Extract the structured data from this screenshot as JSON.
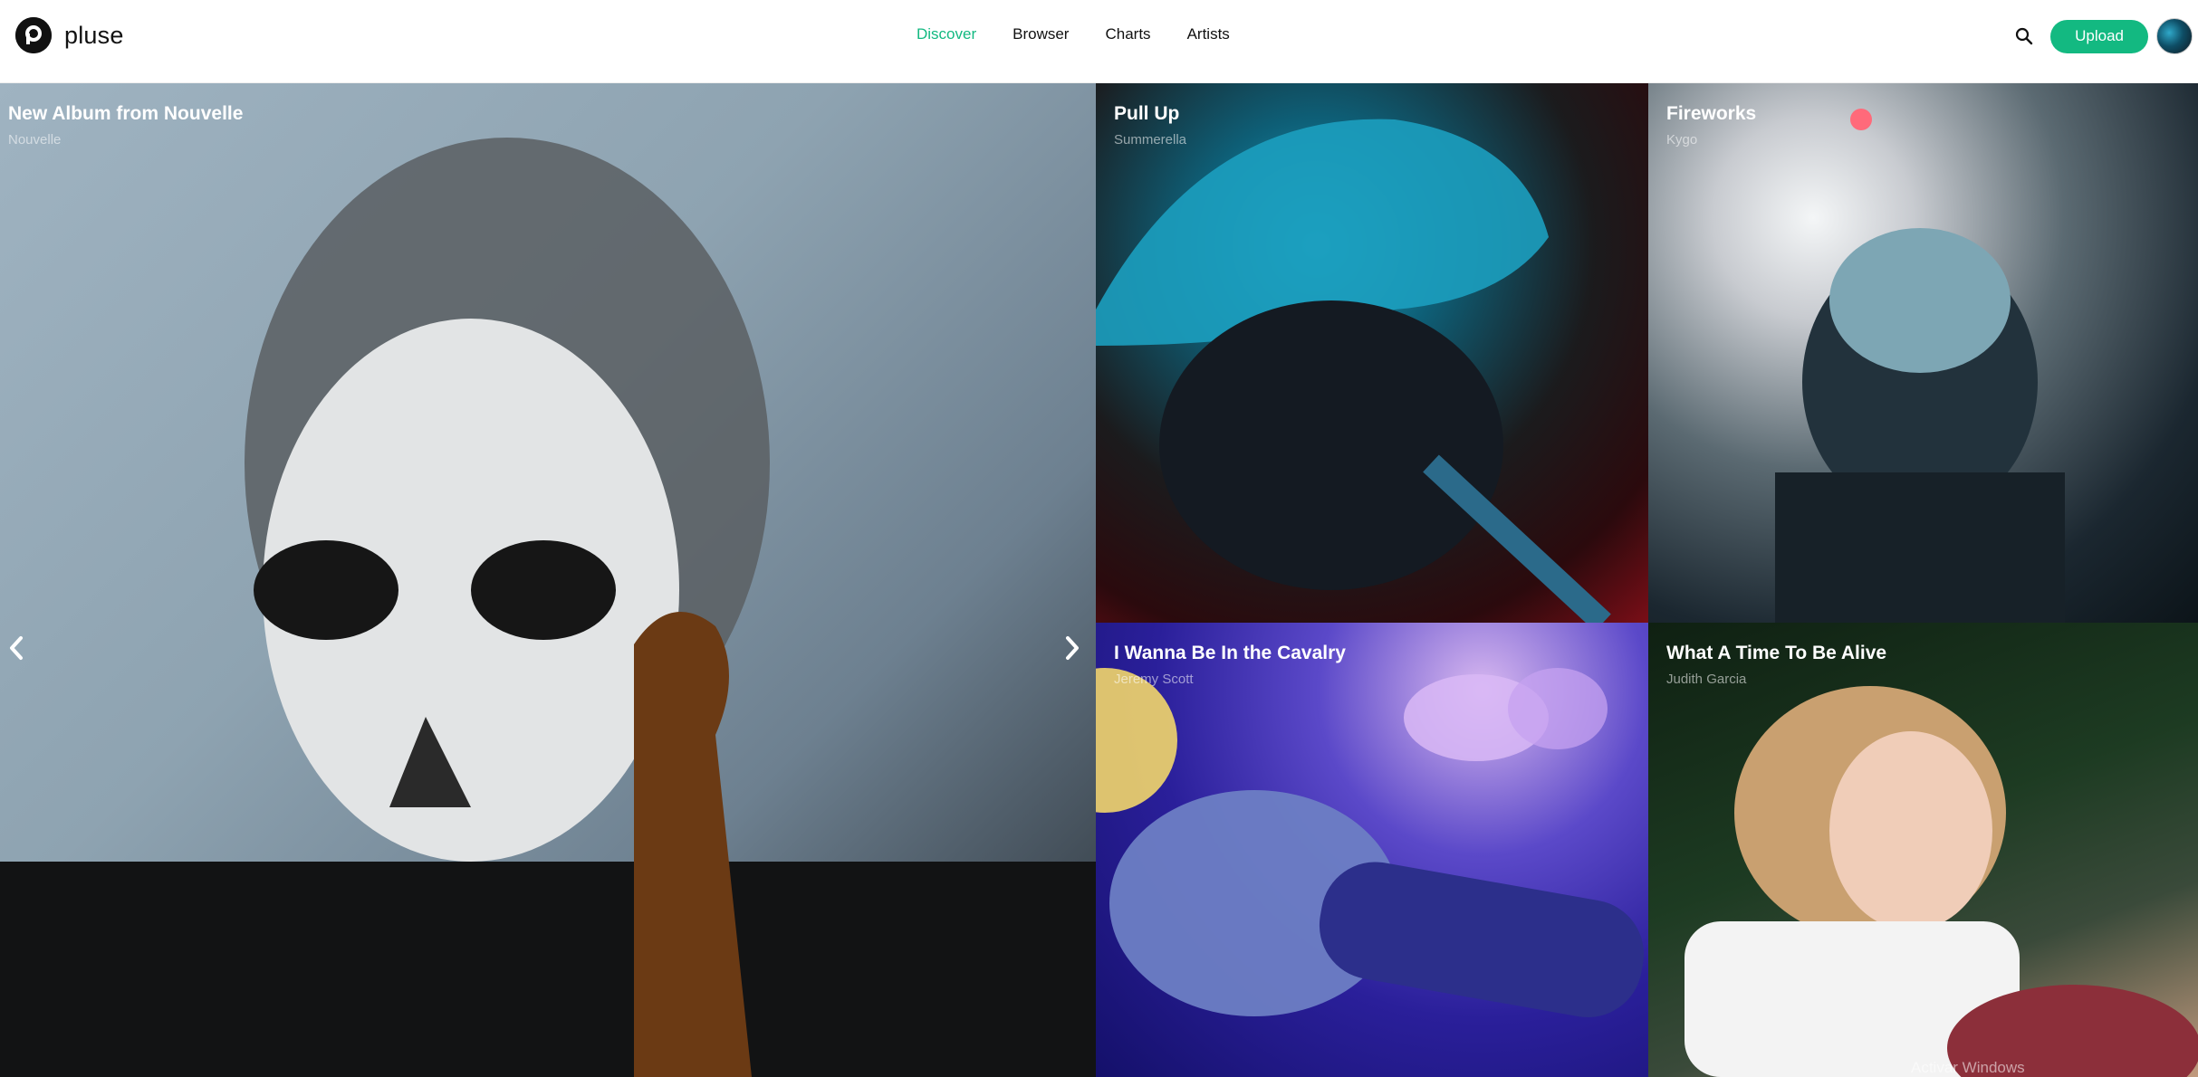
{
  "brand": {
    "name": "pluse"
  },
  "nav": [
    {
      "label": "Discover",
      "active": true
    },
    {
      "label": "Browser",
      "active": false
    },
    {
      "label": "Charts",
      "active": false
    },
    {
      "label": "Artists",
      "active": false
    }
  ],
  "header": {
    "upload_label": "Upload",
    "search_icon": "search-icon"
  },
  "colors": {
    "accent": "#13b981"
  },
  "tiles": [
    {
      "title": "New Album from Nouvelle",
      "artist": "Nouvelle"
    },
    {
      "title": "Pull Up",
      "artist": "Summerella"
    },
    {
      "title": "Fireworks",
      "artist": "Kygo"
    },
    {
      "title": "I Wanna Be In the Cavalry",
      "artist": "Jeremy Scott"
    },
    {
      "title": "What A Time To Be Alive",
      "artist": "Judith Garcia"
    }
  ],
  "watermark": "Activar Windows"
}
